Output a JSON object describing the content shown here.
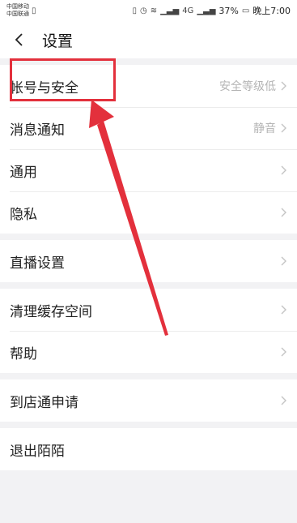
{
  "status": {
    "carrier1": "中国移动",
    "carrier2": "中国联通",
    "battery": "37%",
    "time": "晚上7:00",
    "network1": "4G",
    "network2": "4G"
  },
  "header": {
    "title": "设置"
  },
  "groups": [
    [
      {
        "label": "帐号与安全",
        "value": "安全等级低"
      },
      {
        "label": "消息通知",
        "value": "静音"
      },
      {
        "label": "通用",
        "value": ""
      },
      {
        "label": "隐私",
        "value": ""
      }
    ],
    [
      {
        "label": "直播设置",
        "value": ""
      }
    ],
    [
      {
        "label": "清理缓存空间",
        "value": ""
      },
      {
        "label": "帮助",
        "value": ""
      }
    ],
    [
      {
        "label": "到店通申请",
        "value": ""
      }
    ],
    [
      {
        "label": "退出陌陌",
        "value": ""
      }
    ]
  ],
  "colors": {
    "annotation": "#e3303c",
    "background": "#f2f2f4"
  }
}
